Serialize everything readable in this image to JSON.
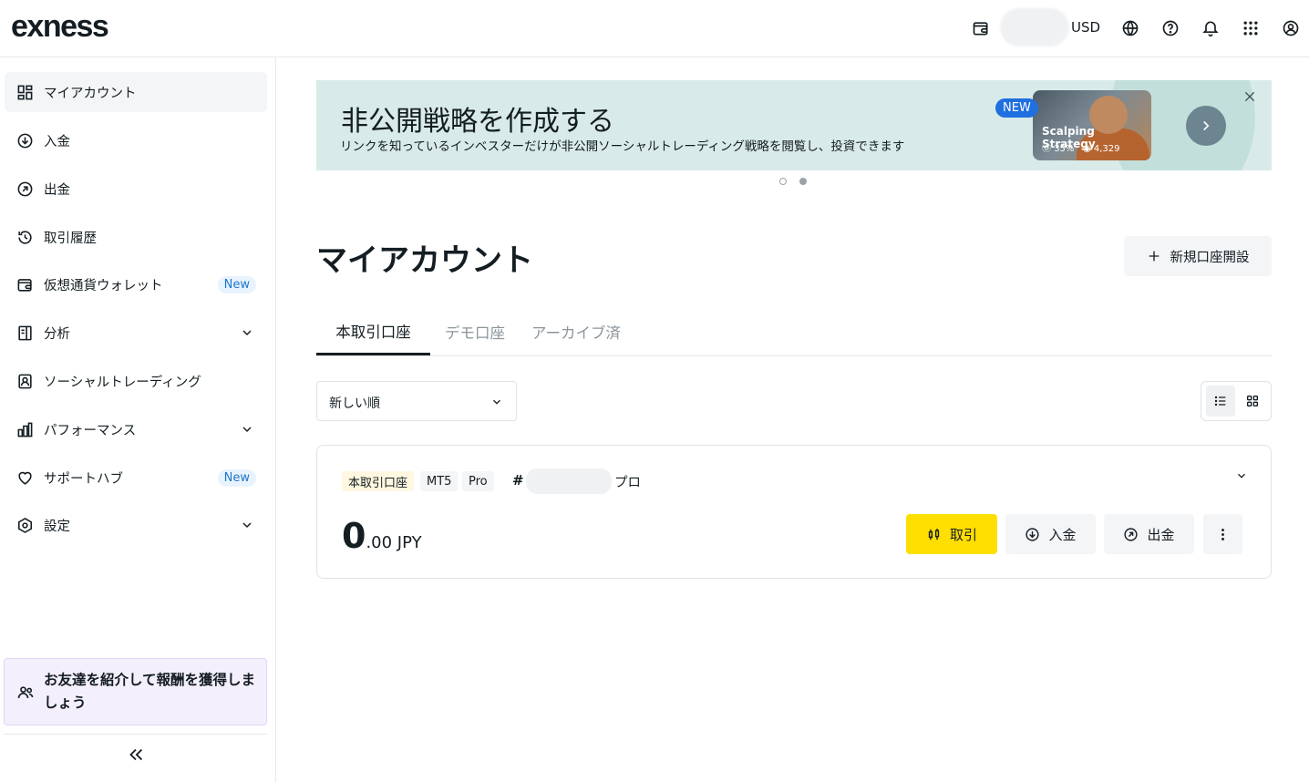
{
  "header": {
    "logo": "exness",
    "currency": "USD"
  },
  "sidebar": {
    "items": [
      {
        "label": "マイアカウント"
      },
      {
        "label": "入金"
      },
      {
        "label": "出金"
      },
      {
        "label": "取引履歴"
      },
      {
        "label": "仮想通貨ウォレット",
        "badge": "New"
      },
      {
        "label": "分析"
      },
      {
        "label": "ソーシャルトレーディング"
      },
      {
        "label": "パフォーマンス"
      },
      {
        "label": "サポートハブ",
        "badge": "New"
      },
      {
        "label": "設定"
      }
    ],
    "referral": "お友達を紹介して報酬を獲得しましょう"
  },
  "banner": {
    "title": "非公開戦略を作成する",
    "subtitle": "リンクを知っているインベスターだけが非公開ソーシャルトレーディング戦略を閲覧し、投資できます",
    "badge": "NEW",
    "card_title": "Scalping Strategy",
    "card_stat1": "35%",
    "card_stat2": "4,329"
  },
  "page": {
    "title": "マイアカウント",
    "open_account": "新規口座開設",
    "tabs": [
      "本取引口座",
      "デモ口座",
      "アーカイブ済"
    ],
    "sort": "新しい順"
  },
  "account": {
    "tags": [
      "本取引口座",
      "MT5",
      "Pro"
    ],
    "hash": "#",
    "name": "プロ",
    "balance_int": "0",
    "balance_dec": ".00 JPY",
    "actions": {
      "trade": "取引",
      "deposit": "入金",
      "withdraw": "出金"
    }
  },
  "colors": {
    "trade_button": "#ffde02",
    "banner_bg": "#d9ebe9",
    "new_badge": "#2277c9"
  }
}
